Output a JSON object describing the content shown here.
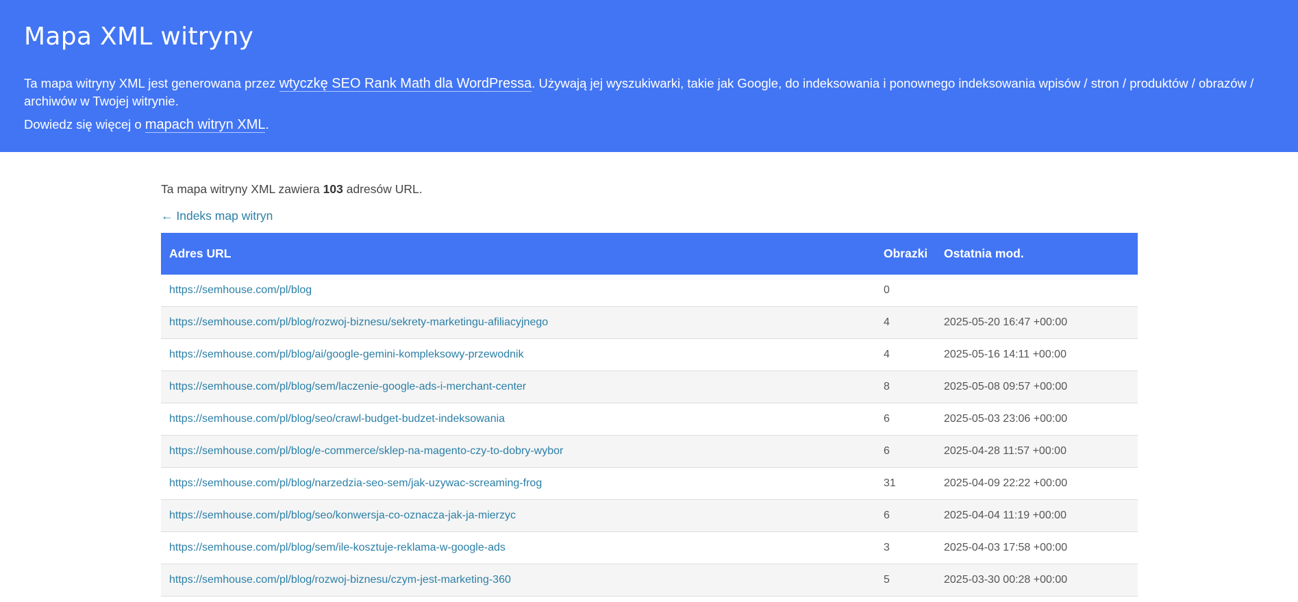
{
  "header": {
    "title": "Mapa XML witryny",
    "intro_before": "Ta mapa witryny XML jest generowana przez ",
    "intro_link": "wtyczkę SEO Rank Math dla WordPressa",
    "intro_after": ". Używają jej wyszukiwarki, takie jak Google, do indeksowania i ponownego indeksowania wpisów / stron / produktów / obrazów / archiwów w Twojej witrynie.",
    "learn_before": "Dowiedz się więcej o ",
    "learn_link": "mapach witryn XML",
    "learn_after": "."
  },
  "content": {
    "summary_before": "Ta mapa witryny XML zawiera ",
    "summary_count": "103",
    "summary_after": " adresów URL.",
    "back_link": "← Indeks map witryn"
  },
  "table": {
    "headers": [
      "Adres URL",
      "Obrazki",
      "Ostatnia mod."
    ],
    "rows": [
      {
        "url": "https://semhouse.com/pl/blog",
        "images": "0",
        "modified": ""
      },
      {
        "url": "https://semhouse.com/pl/blog/rozwoj-biznesu/sekrety-marketingu-afiliacyjnego",
        "images": "4",
        "modified": "2025-05-20 16:47 +00:00"
      },
      {
        "url": "https://semhouse.com/pl/blog/ai/google-gemini-kompleksowy-przewodnik",
        "images": "4",
        "modified": "2025-05-16 14:11 +00:00"
      },
      {
        "url": "https://semhouse.com/pl/blog/sem/laczenie-google-ads-i-merchant-center",
        "images": "8",
        "modified": "2025-05-08 09:57 +00:00"
      },
      {
        "url": "https://semhouse.com/pl/blog/seo/crawl-budget-budzet-indeksowania",
        "images": "6",
        "modified": "2025-05-03 23:06 +00:00"
      },
      {
        "url": "https://semhouse.com/pl/blog/e-commerce/sklep-na-magento-czy-to-dobry-wybor",
        "images": "6",
        "modified": "2025-04-28 11:57 +00:00"
      },
      {
        "url": "https://semhouse.com/pl/blog/narzedzia-seo-sem/jak-uzywac-screaming-frog",
        "images": "31",
        "modified": "2025-04-09 22:22 +00:00"
      },
      {
        "url": "https://semhouse.com/pl/blog/seo/konwersja-co-oznacza-jak-ja-mierzyc",
        "images": "6",
        "modified": "2025-04-04 11:19 +00:00"
      },
      {
        "url": "https://semhouse.com/pl/blog/sem/ile-kosztuje-reklama-w-google-ads",
        "images": "3",
        "modified": "2025-04-03 17:58 +00:00"
      },
      {
        "url": "https://semhouse.com/pl/blog/rozwoj-biznesu/czym-jest-marketing-360",
        "images": "5",
        "modified": "2025-03-30 00:28 +00:00"
      }
    ]
  },
  "colors": {
    "header_bg": "#4275f4",
    "link": "#2b7fa6",
    "row_alt": "#f5f5f5"
  }
}
